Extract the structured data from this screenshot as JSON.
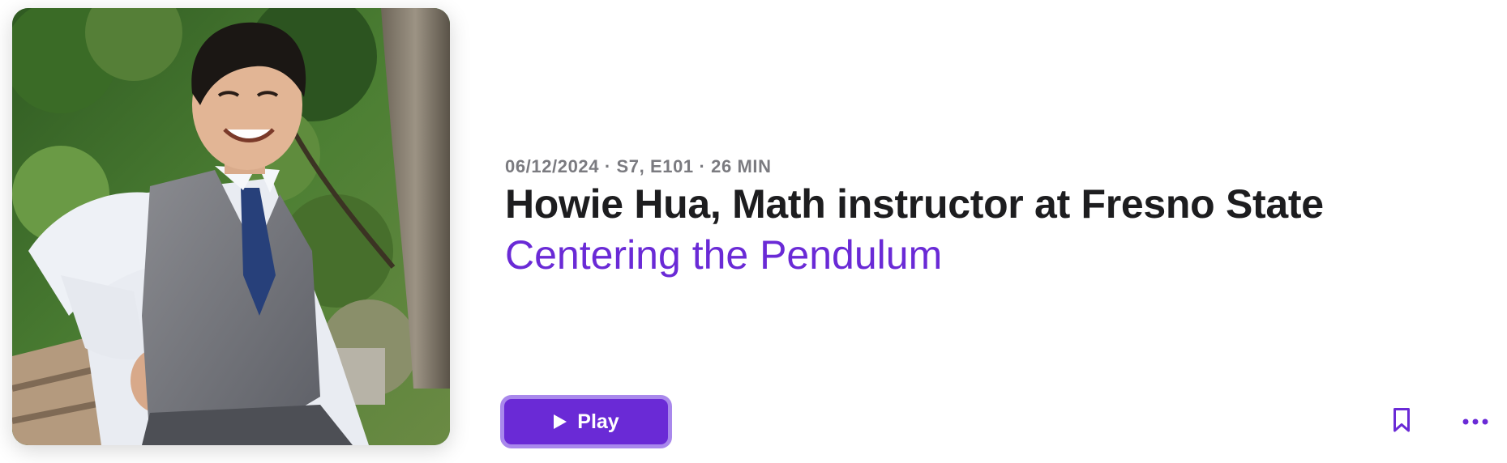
{
  "episode": {
    "artwork_alt": "Howie Hua",
    "meta": "06/12/2024 · S7, E101 · 26 MIN",
    "title": "Howie Hua, Math instructor at Fresno State",
    "show_name": "Centering the Pendulum"
  },
  "actions": {
    "play_label": "Play",
    "play_icon": "play-icon",
    "bookmark_icon": "bookmark-icon",
    "more_icon": "more-icon"
  },
  "colors": {
    "accent": "#6a2ad6",
    "accent_ring": "#a988ec",
    "title": "#1d1d1f",
    "meta": "#7b7b80"
  }
}
